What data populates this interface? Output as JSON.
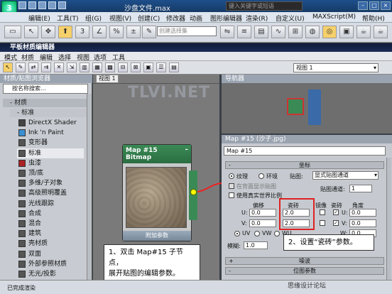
{
  "window": {
    "title": "沙盘文件.max",
    "search_placeholder": "键入关键字或短语",
    "logo": "3",
    "btn_min": "–",
    "btn_max": "□",
    "btn_close": "×"
  },
  "main_menu": [
    "编辑(E)",
    "工具(T)",
    "组(G)",
    "视图(V)",
    "创建(C)",
    "修改器",
    "动画",
    "图形编辑器",
    "渲染(R)",
    "自定义(U)",
    "MAXScript(M)",
    "帮助(H)"
  ],
  "main_toolbar": {
    "selection_set_placeholder": "创建选择集"
  },
  "slate": {
    "title": "平板材质编辑器",
    "menu": [
      "模式",
      "材质",
      "编辑",
      "选择",
      "视图",
      "选项",
      "工具"
    ],
    "view_dropdown": "视图 1"
  },
  "browser": {
    "header": "材质/贴图浏览器",
    "search_placeholder": "按名称搜索...",
    "category": "- 材质",
    "subcategory": "- 标准",
    "items": [
      {
        "label": "DirectX Shader",
        "color": "#444444"
      },
      {
        "label": "Ink 'n Paint",
        "color": "#3b8fd0"
      },
      {
        "label": "变形器",
        "color": "#555555"
      },
      {
        "label": "标准",
        "color": "#555555"
      },
      {
        "label": "虫漆",
        "color": "#aa2222"
      },
      {
        "label": "顶/底",
        "color": "#555555"
      },
      {
        "label": "多维/子对象",
        "color": "#555555"
      },
      {
        "label": "高级照明覆盖",
        "color": "#555555"
      },
      {
        "label": "光线跟踪",
        "color": "#555555"
      },
      {
        "label": "合成",
        "color": "#555555"
      },
      {
        "label": "混合",
        "color": "#555555"
      },
      {
        "label": "建筑",
        "color": "#555555"
      },
      {
        "label": "壳材质",
        "color": "#555555"
      },
      {
        "label": "双面",
        "color": "#555555"
      },
      {
        "label": "外部参照材质",
        "color": "#555555"
      },
      {
        "label": "无光/投影",
        "color": "#555555"
      }
    ]
  },
  "view": {
    "tab": "视图 1"
  },
  "node": {
    "title": "Map #15",
    "subtitle": "Bitmap",
    "footer": "附加参数"
  },
  "navigator": {
    "header": "导航器"
  },
  "params": {
    "header": "Map #15 (沙子.jpg)",
    "name_field": "Map #15",
    "coords_rollout": "坐标",
    "texture": "纹理",
    "environ": "环境",
    "mapping_label": "贴图:",
    "mapping_value": "显式贴图通道",
    "show_map_back": "在背面显示贴图",
    "map_channel_label": "贴图通道:",
    "map_channel_value": "1",
    "real_world": "使用真实世界比例",
    "offset_label": "偏移",
    "tiling_label": "瓷砖",
    "mirror_label": "镜像",
    "tile_label": "瓷砖",
    "angle_label": "角度",
    "u_label": "U:",
    "v_label": "V:",
    "w_label": "W:",
    "offset_u": "0.0",
    "offset_v": "0.0",
    "tiling_u": "2.0",
    "tiling_v": "2.0",
    "angle_u": "0.0",
    "angle_v": "0.0",
    "angle_w": "0.0",
    "uv": "UV",
    "vw": "VW",
    "wu": "WU",
    "blur_label": "模糊:",
    "blur_value": "1.0",
    "noise_rollout": "噪波",
    "bitmap_rollout": "位图参数"
  },
  "callouts": {
    "step1_line1": "1、双击 Map#15 子节点，",
    "step1_line2": "展开贴图的编辑参数。",
    "step2": "2、设置“瓷砖”参数。"
  },
  "watermark": {
    "site": "TLVI.NET",
    "cn": "思缘设计论坛"
  },
  "status": {
    "text": "已完成渲染"
  }
}
